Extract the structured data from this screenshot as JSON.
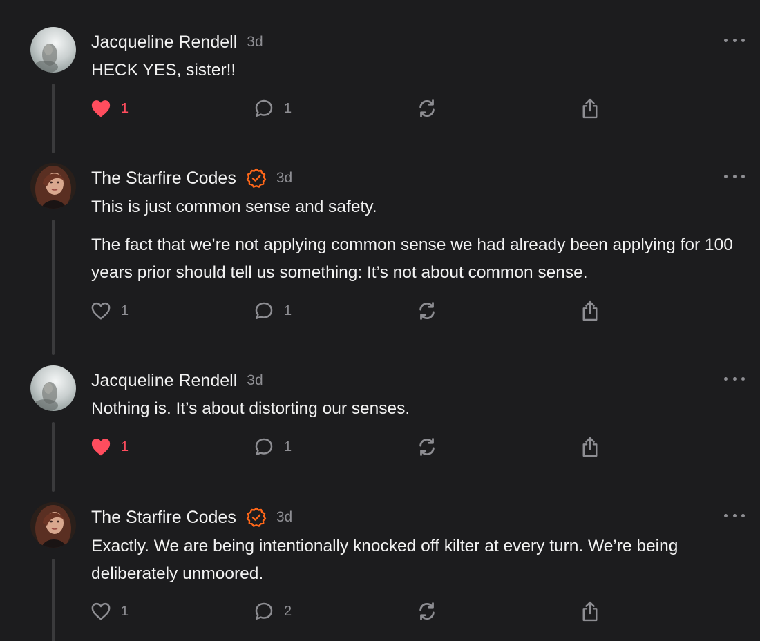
{
  "colors": {
    "background": "#1c1c1e",
    "text_primary": "#f2f2f2",
    "text_secondary": "#8e8e93",
    "like_active": "#ff4d5e",
    "verified_badge": "#ff6719",
    "thread_line": "#3a3a3c"
  },
  "icons": {
    "more": "more-horizontal-icon",
    "like": "heart-icon",
    "reply": "speech-bubble-icon",
    "restack": "restack-icon",
    "share": "share-icon",
    "verified": "verified-check-badge-icon"
  },
  "comments": [
    {
      "author": "Jacqueline Rendell",
      "verified": false,
      "time": "3d",
      "paragraphs": [
        "HECK YES, sister!!"
      ],
      "likes": "1",
      "liked": true,
      "replies": "1"
    },
    {
      "author": "The Starfire Codes",
      "verified": true,
      "time": "3d",
      "paragraphs": [
        "This is just common sense and safety.",
        "The fact that we’re not applying common sense we had already been applying for 100 years prior should tell us something: It’s not about common sense."
      ],
      "likes": "1",
      "liked": false,
      "replies": "1"
    },
    {
      "author": "Jacqueline Rendell",
      "verified": false,
      "time": "3d",
      "paragraphs": [
        "Nothing is. It’s about distorting our senses."
      ],
      "likes": "1",
      "liked": true,
      "replies": "1"
    },
    {
      "author": "The Starfire Codes",
      "verified": true,
      "time": "3d",
      "paragraphs": [
        "Exactly. We are being intentionally knocked off kilter at every turn. We’re being deliberately unmoored."
      ],
      "likes": "1",
      "liked": false,
      "replies": "2"
    }
  ]
}
